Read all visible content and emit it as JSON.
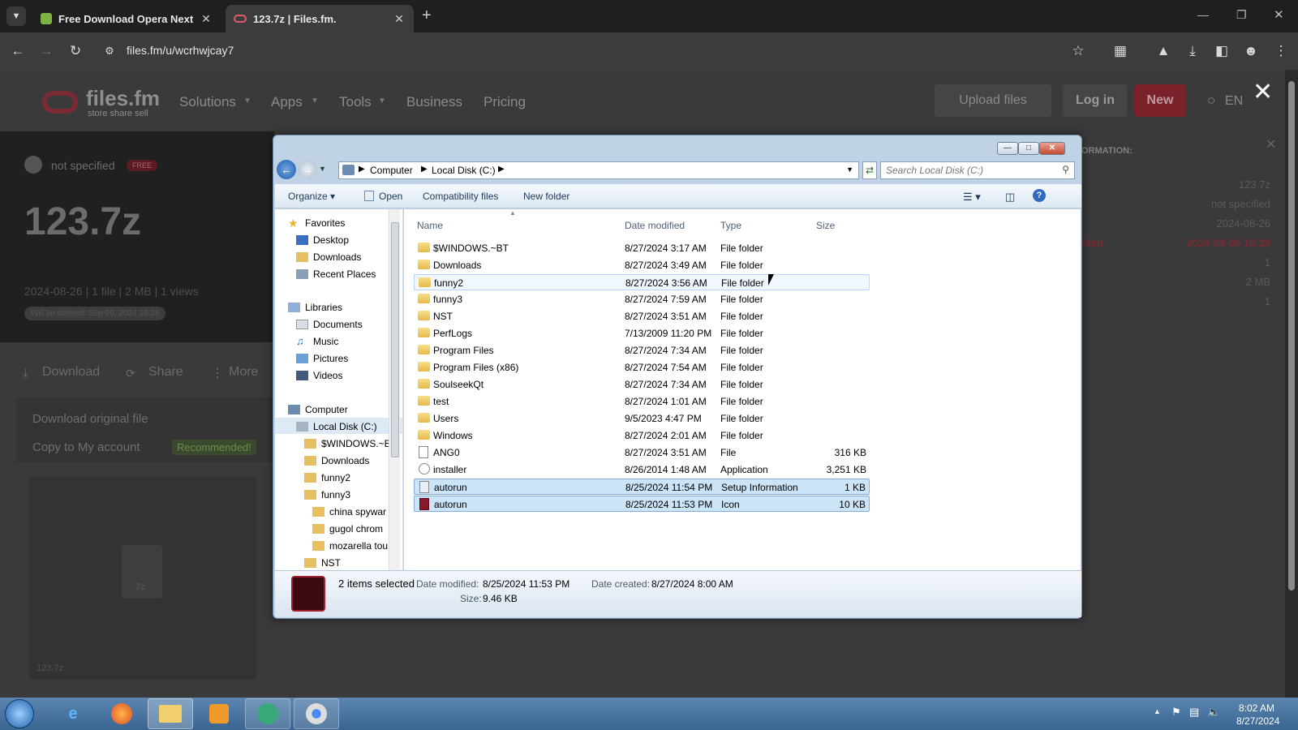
{
  "browser": {
    "tabs": [
      {
        "title": "Free Download Opera Next",
        "active": false
      },
      {
        "title": "123.7z | Files.fm.",
        "active": true
      }
    ],
    "url": "files.fm/u/wcrhwjcay7"
  },
  "site": {
    "logo_name": "files.fm",
    "logo_tagline": "store share sell",
    "nav": [
      "Solutions",
      "Apps",
      "Tools",
      "Business",
      "Pricing"
    ],
    "upload_label": "Upload files",
    "login_label": "Log in",
    "new_label": "New",
    "lang_label": "EN",
    "owner": "not specified",
    "plan_badge": "FREE",
    "file_title": "123.7z",
    "file_meta": "2024-08-26 | 1 file | 2 MB | 1 views",
    "delete_notice": "Will be deleted: Sep 09, 2024 16:28",
    "actions": [
      "Download",
      "Share",
      "More"
    ],
    "download_original": "Download original file",
    "copy_to_account": "Copy to My account",
    "recommended": "Recommended!",
    "thumb_ext": "7z",
    "thumb_name": "123.7z",
    "side_heading": "ORMATION:",
    "side_values": [
      "123.7z",
      "not specified",
      "2024-08-26",
      "2024-09-09 16:28",
      "1",
      "2 MB",
      "1"
    ],
    "side_label_deleted": "eted"
  },
  "explorer": {
    "breadcrumb": [
      "Computer",
      "Local Disk (C:)"
    ],
    "search_placeholder": "Search Local Disk (C:)",
    "commands": [
      "Organize",
      "Open",
      "Compatibility files",
      "New folder"
    ],
    "columns": [
      "Name",
      "Date modified",
      "Type",
      "Size"
    ],
    "nav": {
      "favorites": "Favorites",
      "fav_items": [
        "Desktop",
        "Downloads",
        "Recent Places"
      ],
      "libraries": "Libraries",
      "lib_items": [
        "Documents",
        "Music",
        "Pictures",
        "Videos"
      ],
      "computer": "Computer",
      "drive": "Local Disk (C:)",
      "drive_items": [
        "$WINDOWS.~B",
        "Downloads",
        "funny2",
        "funny3"
      ],
      "sub_items": [
        "china spywar",
        "gugol chrom",
        "mozarella tou"
      ],
      "last": "NST"
    },
    "files": [
      {
        "name": "$WINDOWS.~BT",
        "date": "8/27/2024 3:17 AM",
        "type": "File folder",
        "size": "",
        "kind": "folder"
      },
      {
        "name": "Downloads",
        "date": "8/27/2024 3:49 AM",
        "type": "File folder",
        "size": "",
        "kind": "folder"
      },
      {
        "name": "funny2",
        "date": "8/27/2024 3:56 AM",
        "type": "File folder",
        "size": "",
        "kind": "folder"
      },
      {
        "name": "funny3",
        "date": "8/27/2024 7:59 AM",
        "type": "File folder",
        "size": "",
        "kind": "folder"
      },
      {
        "name": "NST",
        "date": "8/27/2024 3:51 AM",
        "type": "File folder",
        "size": "",
        "kind": "folder"
      },
      {
        "name": "PerfLogs",
        "date": "7/13/2009 11:20 PM",
        "type": "File folder",
        "size": "",
        "kind": "folder"
      },
      {
        "name": "Program Files",
        "date": "8/27/2024 7:34 AM",
        "type": "File folder",
        "size": "",
        "kind": "folder"
      },
      {
        "name": "Program Files (x86)",
        "date": "8/27/2024 7:54 AM",
        "type": "File folder",
        "size": "",
        "kind": "folder"
      },
      {
        "name": "SoulseekQt",
        "date": "8/27/2024 7:34 AM",
        "type": "File folder",
        "size": "",
        "kind": "folder"
      },
      {
        "name": "test",
        "date": "8/27/2024 1:01 AM",
        "type": "File folder",
        "size": "",
        "kind": "folder"
      },
      {
        "name": "Users",
        "date": "9/5/2023 4:47 PM",
        "type": "File folder",
        "size": "",
        "kind": "folder"
      },
      {
        "name": "Windows",
        "date": "8/27/2024 2:01 AM",
        "type": "File folder",
        "size": "",
        "kind": "folder"
      },
      {
        "name": "ANG0",
        "date": "8/27/2024 3:51 AM",
        "type": "File",
        "size": "316 KB",
        "kind": "file"
      },
      {
        "name": "installer",
        "date": "8/26/2014 1:48 AM",
        "type": "Application",
        "size": "3,251 KB",
        "kind": "app"
      },
      {
        "name": "autorun",
        "date": "8/25/2024 11:54 PM",
        "type": "Setup Information",
        "size": "1 KB",
        "kind": "inf"
      },
      {
        "name": "autorun",
        "date": "8/25/2024 11:53 PM",
        "type": "Icon",
        "size": "10 KB",
        "kind": "ico"
      }
    ],
    "details": {
      "selected": "2 items selected",
      "modified_label": "Date modified:",
      "modified": "8/25/2024 11:53 PM",
      "created_label": "Date created:",
      "created": "8/27/2024 8:00 AM",
      "size_label": "Size:",
      "size": "9.46 KB"
    }
  },
  "taskbar": {
    "time": "8:02 AM",
    "date": "8/27/2024"
  }
}
